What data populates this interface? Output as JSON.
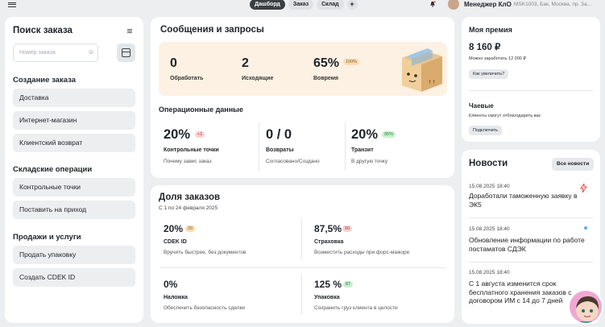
{
  "topbar": {
    "tabs": [
      "Дашборд",
      "Заказ",
      "Склад"
    ],
    "plus": "+",
    "user_name": "Менеджер КлО",
    "office": "MSK1003, Бак, Москва, пр. За..."
  },
  "left": {
    "title": "Поиск заказа",
    "search_placeholder": "Номер заказа",
    "sections": [
      {
        "title": "Создание заказа",
        "items": [
          "Доставка",
          "Интернет-магазин",
          "Клиентский возврат"
        ]
      },
      {
        "title": "Складские операции",
        "items": [
          "Контрольные точки",
          "Поставить на приход"
        ]
      },
      {
        "title": "Продажи и услуги",
        "items": [
          "Продать упаковку",
          "Создать CDEK ID"
        ]
      }
    ]
  },
  "messages": {
    "title": "Сообщения и запросы",
    "stats": [
      {
        "value": "0",
        "label": "Обработать"
      },
      {
        "value": "2",
        "label": "Исходящие"
      },
      {
        "value": "65%",
        "label": "Вовремя",
        "badge": "100%"
      }
    ],
    "ops_title": "Операционные данные",
    "ops": [
      {
        "value": "20%",
        "badge": "+1",
        "label": "Контрольные точки",
        "sub": "Почему завис заказ"
      },
      {
        "value": "0 / 0",
        "label": "Возвраты",
        "sub": "Согласовано/Создано"
      },
      {
        "value": "20%",
        "badge": "95%",
        "label": "Транзит",
        "sub": "В другую точку"
      }
    ]
  },
  "orders_share": {
    "title": "Доля заказов",
    "period": "С 1 по 24 февраля 2025",
    "items": [
      {
        "value": "20%",
        "badge": "20",
        "label": "CDEK ID",
        "sub": "Вручить быстрее, без документов"
      },
      {
        "value": "87,5%",
        "badge": "90",
        "label": "Страховка",
        "sub": "Возместить расходы при форс-мажоре"
      },
      {
        "value": "0%",
        "label": "Наложка",
        "sub": "Обеспечить безопасность сделки"
      },
      {
        "value": "125 %",
        "badge": "87",
        "label": "Упаковка",
        "sub": "Сохранить груз клиента в целости"
      }
    ]
  },
  "bonus": {
    "title": "Моя премия",
    "amount": "8 160 ₽",
    "potential": "Можно заработать 12 000 ₽",
    "increase_btn": "Как увеличить?",
    "tips_title": "Чаевые",
    "tips_sub": "Клиенты смогут отблагодарить вас",
    "connect_btn": "Подключить"
  },
  "news": {
    "title": "Новости",
    "all_btn": "Все новости",
    "items": [
      {
        "date": "15.08.2025 18:40",
        "text": "Доработали таможенную заявку в ЭК5"
      },
      {
        "date": "15.08.2025 18:40",
        "text": "Обновление информации по работе постаматов СДЭК"
      },
      {
        "date": "15.08.2025 18:40",
        "text": "С 1 августа изменится срок бесплатного хранения заказов с договором ИМ с 14 до 7 дней"
      }
    ]
  },
  "colors": {
    "accent_green": "#2f7a3e",
    "band_bg": "#fdf1e3",
    "tab_active": "#3a3f44"
  }
}
